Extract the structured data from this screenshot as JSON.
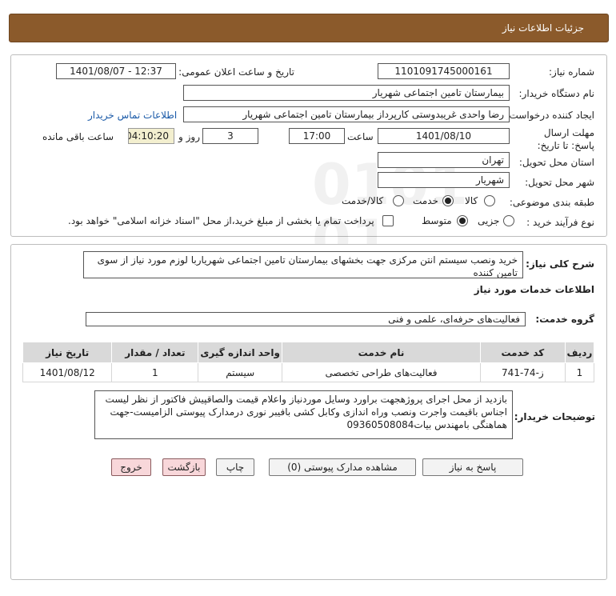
{
  "header": {
    "title": "جزئیات اطلاعات نیاز"
  },
  "fields": {
    "need_number_label": "شماره نیاز:",
    "need_number": "1101091745000161",
    "announce_label": "تاریخ و ساعت اعلان عمومی:",
    "announce_value": "1401/08/07 - 12:37",
    "buyer_org_label": "نام دستگاه خریدار:",
    "buyer_org": "بیمارستان تامین اجتماعی شهریار",
    "creator_label": "ایجاد کننده درخواست:",
    "creator": "رضا واحدی غریبدوستی کارپرداز بیمارستان تامین اجتماعی شهریار",
    "contact_link": "اطلاعات تماس خریدار",
    "deadline_label": "مهلت ارسال پاسخ: تا تاریخ:",
    "deadline_date": "1401/08/10",
    "time_label": "ساعت",
    "deadline_time": "17:00",
    "days_value": "3",
    "days_label": "روز و",
    "remaining_value": "04:10:20",
    "remaining_label": "ساعت باقی مانده",
    "province_label": "استان محل تحویل:",
    "province": "تهران",
    "city_label": "شهر محل تحویل:",
    "city": "شهریار",
    "category_label": "طبقه بندی موضوعی:",
    "category_options": [
      "کالا",
      "خدمت",
      "کالا/خدمت"
    ],
    "category_selected": "خدمت",
    "process_label": "نوع فرآیند خرید :",
    "process_options": [
      "جزیی",
      "متوسط"
    ],
    "process_selected": "متوسط",
    "payment_note": "پرداخت تمام یا بخشی از مبلغ خرید،از محل \"اسناد خزانه اسلامی\" خواهد بود."
  },
  "description": {
    "label": "شرح کلی نیاز:",
    "text": "خرید ونصب سیستم انتن مرکزی جهت بخشهای بیمارستان تامین اجتماعی شهریاربا لوزم مورد نیاز از سوی تامین کننده"
  },
  "services": {
    "section_title": "اطلاعات خدمات مورد نیاز",
    "group_label": "گروه خدمت:",
    "group_value": "فعالیت‌های حرفه‌ای، علمی و فنی",
    "table": {
      "headers": [
        "ردیف",
        "کد خدمت",
        "نام خدمت",
        "واحد اندازه گیری",
        "تعداد / مقدار",
        "تاریخ نیاز"
      ],
      "rows": [
        [
          "1",
          "ز-74-741",
          "فعالیت‌های طراحی تخصصی",
          "سیستم",
          "1",
          "1401/08/12"
        ]
      ]
    }
  },
  "buyer_notes": {
    "label": "توضیحات خریدار:",
    "text": "بازدید از محل اجرای پروژهجهت براورد وسایل موردنیاز واعلام قیمت والصاقپیش فاکتور از نظر لیست اجناس باقیمت واجرت ونصب وراه اندازی وکابل کشی بافیبر نوری درمدارک پیوستی الزامیست-جهت هماهنگی بامهندس بیات09360508084"
  },
  "buttons": {
    "reply": "پاسخ به نیاز",
    "attachments": "مشاهده مدارک پیوستی (0)",
    "print": "چاپ",
    "back": "بازگشت",
    "exit": "خروج"
  },
  "watermark": {
    "line1": "ParsNamadData",
    "line2": "مرکز فراوری اطلاعات پارس نماد داده",
    "phone": "۰۲۱-۸۸۳۴۹۶۷۰"
  }
}
